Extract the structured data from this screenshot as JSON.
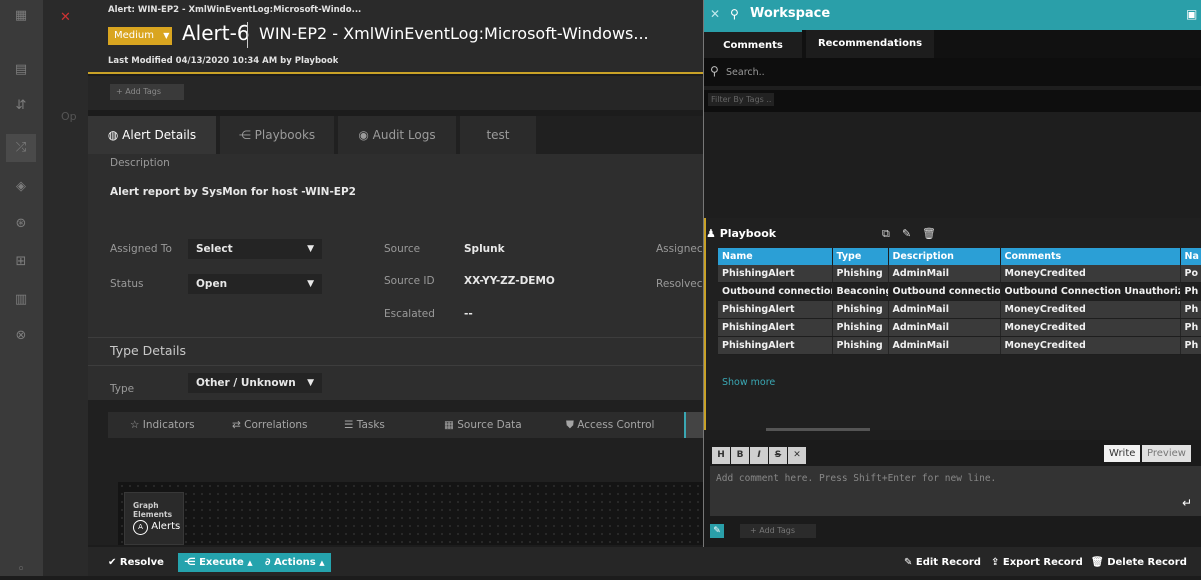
{
  "header": {
    "breadcrumb": "Alert: WIN-EP2 - XmlWinEventLog:Microsoft-Windo...",
    "severity": "Medium",
    "alert_id": "Alert-6",
    "alert_subtitle": "WIN-EP2 - XmlWinEventLog:Microsoft-Windows...",
    "last_modified_label": "Last Modified",
    "last_modified_date": "04/13/2020 10:34 AM",
    "last_modified_by_prefix": "by",
    "last_modified_by": "Playbook",
    "add_tags": "+ Add Tags"
  },
  "partial_text": {
    "op": "Op",
    "assigned_cut": "Assignec",
    "resolved_cut": "Resolvec"
  },
  "tabs": [
    "Alert Details",
    "Playbooks",
    "Audit Logs",
    "test"
  ],
  "details": {
    "description_label": "Description",
    "description_value": "Alert report by SysMon for host -WIN-EP2",
    "assigned_to_label": "Assigned To",
    "assigned_to_value": "Select",
    "status_label": "Status",
    "status_value": "Open",
    "source_label": "Source",
    "source_value": "Splunk",
    "source_id_label": "Source ID",
    "source_id_value": "XX-YY-ZZ-DEMO",
    "escalated_label": "Escalated",
    "escalated_value": "--",
    "type_details_heading": "Type Details",
    "type_label": "Type",
    "type_value": "Other / Unknown"
  },
  "subtabs": [
    "Indicators",
    "Correlations",
    "Tasks",
    "Source Data",
    "Access Control"
  ],
  "graph": {
    "panel_title": "Graph Elements",
    "item": "Alerts"
  },
  "footer": {
    "resolve": "Resolve",
    "execute": "Execute",
    "actions": "Actions",
    "edit_record": "Edit Record",
    "export_record": "Export Record",
    "delete_record": "Delete Record"
  },
  "workspace": {
    "title": "Workspace",
    "tabs": [
      "Comments",
      "Recommendations"
    ],
    "search_placeholder": "Search..",
    "filter_placeholder": "Filter By Tags ..",
    "playbook_title": "Playbook",
    "columns": [
      "Name",
      "Type",
      "Description",
      "Comments",
      "Na"
    ],
    "rows": [
      [
        "PhishingAlert",
        "Phishing",
        "AdminMail",
        "MoneyCredited",
        "Po"
      ],
      [
        "Outbound connection",
        "Beaconing",
        "Outbound connection",
        "Outbound Connection Unauthorized",
        "Ph"
      ],
      [
        "PhishingAlert",
        "Phishing",
        "AdminMail",
        "MoneyCredited",
        "Ph"
      ],
      [
        "PhishingAlert",
        "Phishing",
        "AdminMail",
        "MoneyCredited",
        "Ph"
      ],
      [
        "PhishingAlert",
        "Phishing",
        "AdminMail",
        "MoneyCredited",
        "Ph"
      ]
    ],
    "show_more": "Show more",
    "editor_buttons": [
      "H",
      "B",
      "I",
      "S",
      "✕"
    ],
    "write_tab": "Write",
    "preview_tab": "Preview",
    "comment_placeholder": "Add comment here. Press Shift+Enter for new line.",
    "add_tags": "+ Add Tags"
  },
  "colors": {
    "accent": "#25a3ad",
    "severity": "#d9a520",
    "table_header": "#2b9fd6"
  },
  "icons": [
    "grid-icon",
    "close-icon",
    "caret-down-icon",
    "info-icon",
    "playbook-icon",
    "eye-icon",
    "star-icon",
    "swap-icon",
    "list-icon",
    "table-icon",
    "lock-icon",
    "check-icon",
    "external-link-icon",
    "edit-icon",
    "trash-icon",
    "user-icon",
    "search-icon",
    "attach-icon",
    "export-icon"
  ]
}
